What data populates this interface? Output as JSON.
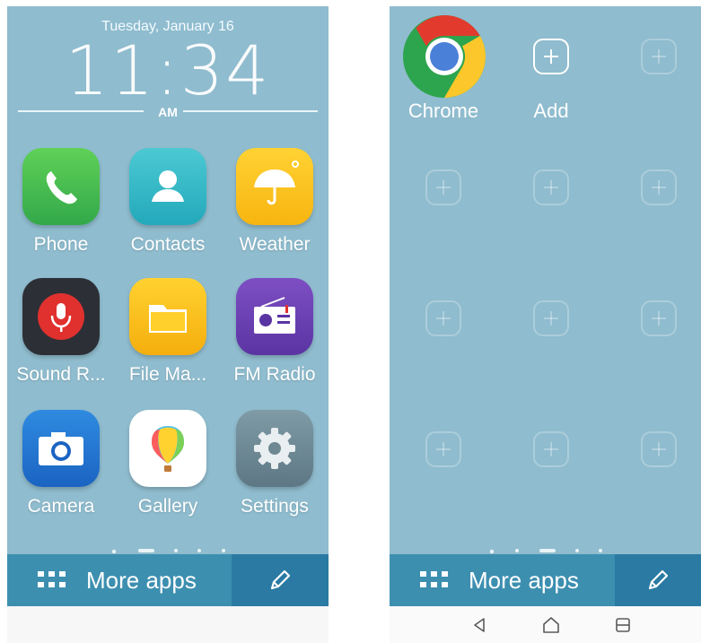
{
  "left_screen": {
    "date": "Tuesday, January 16",
    "time": "11:34",
    "ampm": "AM",
    "apps": [
      {
        "label": "Phone",
        "icon": "phone-icon"
      },
      {
        "label": "Contacts",
        "icon": "contacts-icon"
      },
      {
        "label": "Weather",
        "icon": "weather-icon"
      },
      {
        "label": "Sound R...",
        "icon": "sound-recorder-icon"
      },
      {
        "label": "File Ma...",
        "icon": "file-manager-icon"
      },
      {
        "label": "FM Radio",
        "icon": "fm-radio-icon"
      },
      {
        "label": "Camera",
        "icon": "camera-icon"
      },
      {
        "label": "Gallery",
        "icon": "gallery-icon"
      },
      {
        "label": "Settings",
        "icon": "settings-icon"
      }
    ],
    "dock": {
      "more_apps": "More apps",
      "edit_icon": "pencil-icon"
    },
    "page_dots": 5,
    "active_page": 1
  },
  "right_screen": {
    "apps": [
      {
        "label": "Chrome",
        "icon": "chrome-icon"
      },
      {
        "label": "Add",
        "icon": "add-icon"
      }
    ],
    "dock": {
      "more_apps": "More apps",
      "edit_icon": "pencil-icon"
    },
    "page_dots": 5,
    "active_page": 2,
    "nav": [
      "back-icon",
      "home-icon",
      "recents-icon"
    ]
  },
  "colors": {
    "wallpaper": "#8fbcce",
    "dock": "#3d8fb0",
    "dock_edit": "#2a7aa3"
  }
}
